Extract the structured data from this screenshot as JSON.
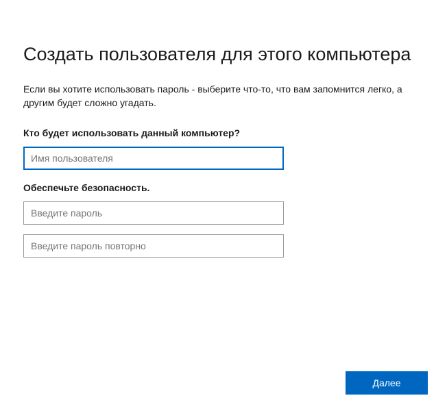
{
  "title": "Создать пользователя для этого компьютера",
  "description": "Если вы хотите использовать пароль - выберите что-то, что вам запомнится легко, а другим будет сложно угадать.",
  "section_user": {
    "label": "Кто будет использовать данный компьютер?",
    "username_placeholder": "Имя пользователя",
    "username_value": ""
  },
  "section_security": {
    "label": "Обеспечьте безопасность.",
    "password_placeholder": "Введите пароль",
    "password_value": "",
    "password_confirm_placeholder": "Введите пароль повторно",
    "password_confirm_value": ""
  },
  "buttons": {
    "next": "Далее"
  }
}
